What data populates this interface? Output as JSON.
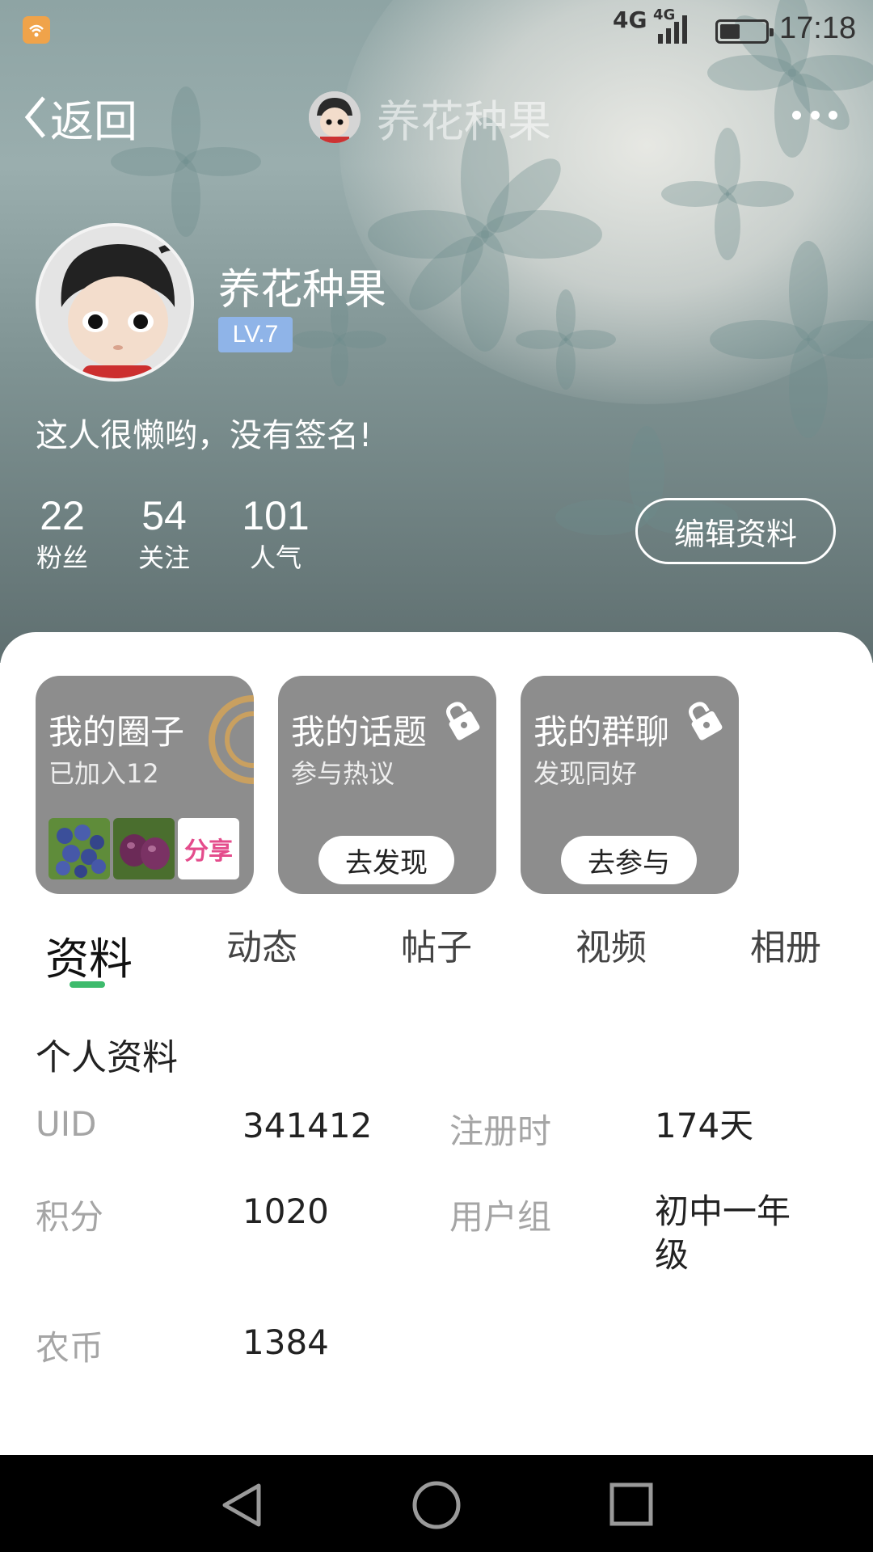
{
  "status_bar": {
    "network1": "4G",
    "network2": "4G",
    "time": "17:18"
  },
  "nav": {
    "back_label": "返回",
    "title": "养花种果"
  },
  "profile": {
    "username": "养花种果",
    "level": "LV.7",
    "signature": "这人很懒哟，没有签名!",
    "stats": [
      {
        "value": "22",
        "label": "粉丝"
      },
      {
        "value": "54",
        "label": "关注"
      },
      {
        "value": "101",
        "label": "人气"
      }
    ],
    "edit_label": "编辑资料"
  },
  "cards": [
    {
      "title": "我的圈子",
      "subtitle": "已加入12",
      "thumb_text": "分享"
    },
    {
      "title": "我的话题",
      "subtitle": "参与热议",
      "button": "去发现"
    },
    {
      "title": "我的群聊",
      "subtitle": "发现同好",
      "button": "去参与"
    }
  ],
  "tabs": [
    "资料",
    "动态",
    "帖子",
    "视频",
    "相册"
  ],
  "info": {
    "section_title": "个人资料",
    "rows": [
      {
        "label1": "UID",
        "value1": "341412",
        "label2": "注册时",
        "value2": "174天"
      },
      {
        "label1": "积分",
        "value1": "1020",
        "label2": "用户组",
        "value2_line1": "初中一年",
        "value2_line2": "级"
      },
      {
        "label1": "农币",
        "value1": "1384"
      }
    ]
  },
  "colors": {
    "accent": "#3dbb6c",
    "level_badge": "#8fb4e8",
    "card_bg": "#8d8d8d"
  }
}
